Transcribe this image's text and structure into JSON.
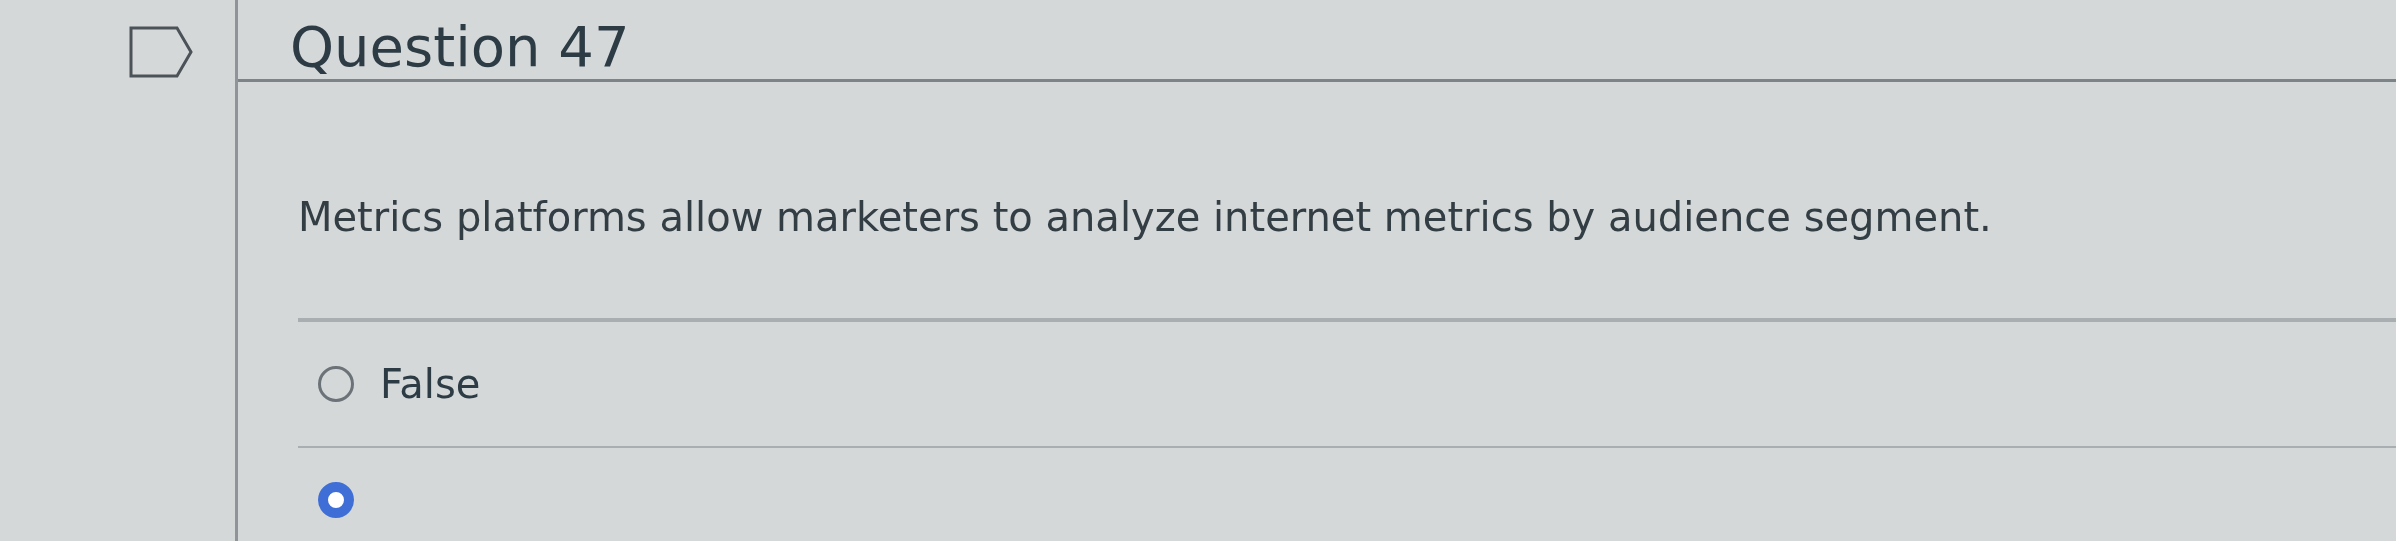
{
  "question": {
    "title": "Question 47",
    "text": "Metrics platforms allow marketers to analyze internet metrics by audience segment."
  },
  "answers": [
    {
      "label": "False",
      "selected": false
    },
    {
      "selected": true
    }
  ]
}
